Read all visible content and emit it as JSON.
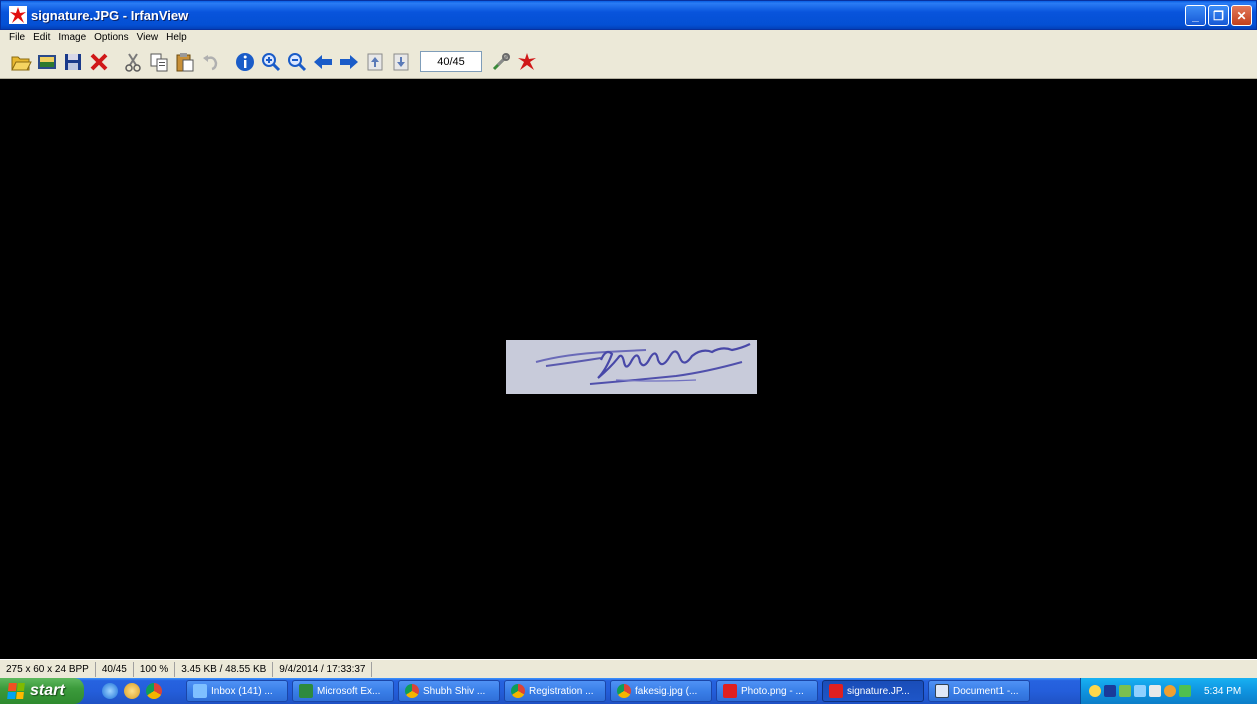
{
  "window": {
    "title": "signature.JPG - IrfanView",
    "controls": [
      "minimize",
      "restore",
      "close"
    ]
  },
  "menu": {
    "items": [
      "File",
      "Edit",
      "Image",
      "Options",
      "View",
      "Help"
    ]
  },
  "toolbar": {
    "page_counter": "40/45",
    "icons": [
      "open-folder-icon",
      "thumbnails-icon",
      "save-icon",
      "delete-icon",
      "cut-icon",
      "copy-icon",
      "paste-icon",
      "undo-icon",
      "info-icon",
      "zoom-in-icon",
      "zoom-out-icon",
      "previous-icon",
      "next-icon",
      "first-icon",
      "last-icon",
      "settings-icon",
      "exit-icon"
    ]
  },
  "status": {
    "dimensions": "275 x 60 x 24 BPP",
    "index": "40/45",
    "zoom": "100 %",
    "size": "3.45 KB / 48.55 KB",
    "datetime": "9/4/2014 / 17:33:37"
  },
  "taskbar": {
    "start_label": "start",
    "tasks": [
      {
        "label": "Inbox (141) ...",
        "icon": "ie-icon"
      },
      {
        "label": "Microsoft Ex...",
        "icon": "excel-icon"
      },
      {
        "label": "Shubh Shiv ...",
        "icon": "chrome-icon"
      },
      {
        "label": "Registration ...",
        "icon": "chrome-icon"
      },
      {
        "label": "fakesig.jpg (...",
        "icon": "chrome-icon"
      },
      {
        "label": "Photo.png - ...",
        "icon": "irfanview-icon"
      },
      {
        "label": "signature.JP...",
        "icon": "irfanview-icon"
      },
      {
        "label": "Document1 -...",
        "icon": "word-icon"
      }
    ],
    "clock": "5:34 PM"
  },
  "colors": {
    "titlebar": "#0854dc",
    "taskbar": "#245edb",
    "start": "#3c9b3c",
    "tray": "#0f94e0",
    "chrome": "#ece9d8"
  }
}
